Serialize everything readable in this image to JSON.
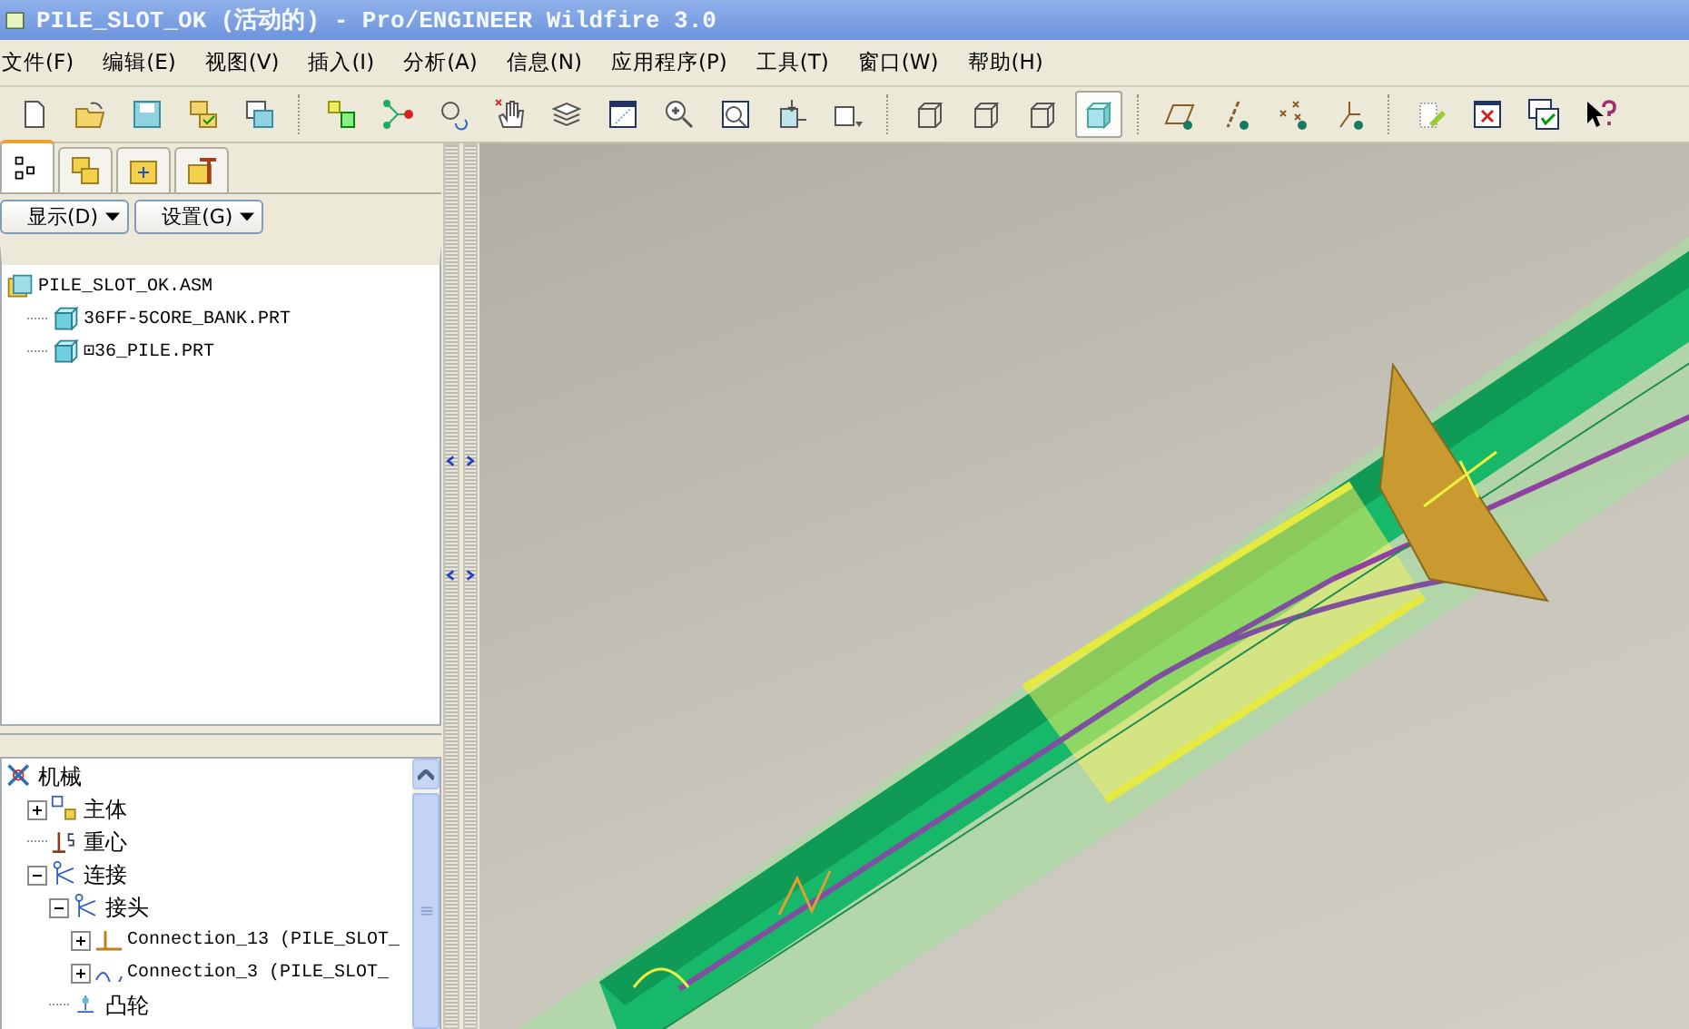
{
  "window": {
    "title": "PILE_SLOT_OK (活动的) - Pro/ENGINEER Wildfire 3.0"
  },
  "menu": [
    "文件(F)",
    "编辑(E)",
    "视图(V)",
    "插入(I)",
    "分析(A)",
    "信息(N)",
    "应用程序(P)",
    "工具(T)",
    "窗口(W)",
    "帮助(H)"
  ],
  "display_styles": [
    {
      "selected": false
    },
    {
      "selected": false
    },
    {
      "selected": false
    },
    {
      "selected": true
    }
  ],
  "navigator_tabs": [
    {
      "selected": true
    },
    {
      "selected": false
    },
    {
      "selected": false
    },
    {
      "selected": false
    }
  ],
  "tree_buttons": [
    "显示(D)",
    "设置(G)"
  ],
  "model_tree": [
    {
      "label": "PILE_SLOT_OK.ASM",
      "kind": "assembly",
      "children": [
        {
          "label": "36FF-5CORE_BANK.PRT",
          "kind": "part"
        },
        {
          "label": "⊡36_PILE.PRT",
          "kind": "part"
        }
      ]
    }
  ],
  "mechanism_tree": [
    {
      "label": "机械",
      "kind": "mechanism",
      "children": [
        {
          "label": "主体",
          "kind": "bodies",
          "expanded": false
        },
        {
          "label": "重心",
          "kind": "gravity"
        },
        {
          "label": "连接",
          "kind": "connections",
          "expanded": true,
          "children": [
            {
              "label": "接头",
              "kind": "joints",
              "expanded": true,
              "children": [
                {
                  "label": "Connection_13 (PILE_SLOT_",
                  "kind": "pin",
                  "expanded": false
                },
                {
                  "label": "Connection_3 (PILE_SLOT_",
                  "kind": "slot",
                  "expanded": false
                }
              ]
            },
            {
              "label": "凸轮",
              "kind": "cam"
            }
          ]
        }
      ]
    }
  ]
}
